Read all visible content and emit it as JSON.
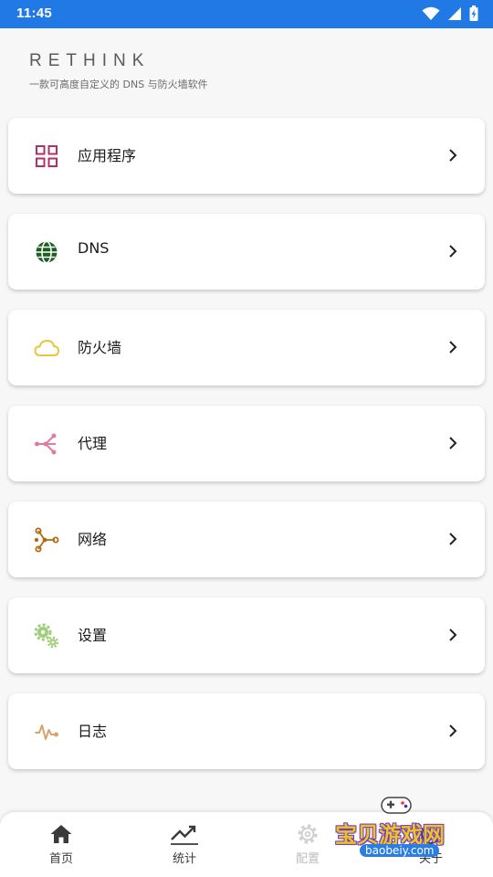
{
  "status_bar": {
    "time": "11:45"
  },
  "header": {
    "title": "RETHINK",
    "subtitle": "一款可高度自定义的 DNS 与防火墙软件"
  },
  "menu": [
    {
      "label": "应用程序",
      "icon": "apps-grid-icon",
      "color": "#b0306a"
    },
    {
      "label": "DNS",
      "icon": "globe-icon",
      "color": "#1b5e20"
    },
    {
      "label": "防火墙",
      "icon": "cloud-icon",
      "color": "#e8c53c"
    },
    {
      "label": "代理",
      "icon": "proxy-share-icon",
      "color": "#e07d9f"
    },
    {
      "label": "网络",
      "icon": "network-nodes-icon",
      "color": "#b06a12"
    },
    {
      "label": "设置",
      "icon": "gears-icon",
      "color": "#9fcf7a"
    },
    {
      "label": "日志",
      "icon": "pulse-log-icon",
      "color": "#d9a16b"
    }
  ],
  "bottom_nav": [
    {
      "label": "首页",
      "icon": "home-icon"
    },
    {
      "label": "统计",
      "icon": "trending-up-icon"
    },
    {
      "label": "配置",
      "icon": "gear-icon"
    },
    {
      "label": "关于",
      "icon": "info-icon"
    }
  ],
  "watermark": {
    "text": "宝贝游戏网",
    "url": "baobeiy.com"
  }
}
